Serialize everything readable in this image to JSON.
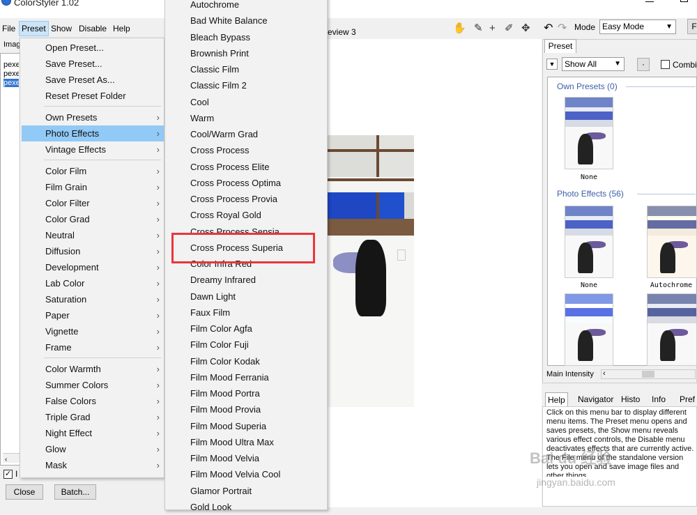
{
  "app": {
    "title": "ColorStyler 1.02"
  },
  "menubar": [
    {
      "label": "File"
    },
    {
      "label": "Preset"
    },
    {
      "label": "Show"
    },
    {
      "label": "Disable"
    },
    {
      "label": "Help"
    }
  ],
  "left_panel": {
    "label": "Imag",
    "files": [
      "pexe",
      "pexe",
      "pexe"
    ],
    "checkbox_label": "I",
    "close_label": "Close",
    "batch_label": "Batch..."
  },
  "preview_tab": "eview 3",
  "preset_menu": {
    "items": [
      {
        "label": "Open Preset...",
        "arrow": ""
      },
      {
        "label": "Save Preset...",
        "arrow": ""
      },
      {
        "label": "Save Preset As...",
        "arrow": ""
      },
      {
        "label": "Reset Preset Folder",
        "arrow": ""
      },
      {
        "label": "Own Presets",
        "arrow": "›"
      },
      {
        "label": "Photo Effects",
        "arrow": "›"
      },
      {
        "label": "Vintage Effects",
        "arrow": "›"
      },
      {
        "label": "Color Film",
        "arrow": "›"
      },
      {
        "label": "Film Grain",
        "arrow": "›"
      },
      {
        "label": "Color Filter",
        "arrow": "›"
      },
      {
        "label": "Color Grad",
        "arrow": "›"
      },
      {
        "label": "Neutral",
        "arrow": "›"
      },
      {
        "label": "Diffusion",
        "arrow": "›"
      },
      {
        "label": "Development",
        "arrow": "›"
      },
      {
        "label": "Lab Color",
        "arrow": "›"
      },
      {
        "label": "Saturation",
        "arrow": "›"
      },
      {
        "label": "Paper",
        "arrow": "›"
      },
      {
        "label": "Vignette",
        "arrow": "›"
      },
      {
        "label": "Frame",
        "arrow": "›"
      },
      {
        "label": "Color Warmth",
        "arrow": "›"
      },
      {
        "label": "Summer Colors",
        "arrow": "›"
      },
      {
        "label": "False Colors",
        "arrow": "›"
      },
      {
        "label": "Triple Grad",
        "arrow": "›"
      },
      {
        "label": "Night Effect",
        "arrow": "›"
      },
      {
        "label": "Glow",
        "arrow": "›"
      },
      {
        "label": "Mask",
        "arrow": "›"
      }
    ]
  },
  "photo_effects_menu": {
    "items": [
      "Autochrome",
      "Bad White Balance",
      "Bleach Bypass",
      "Brownish Print",
      "Classic Film",
      "Classic Film 2",
      "Cool",
      "Warm",
      "Cool/Warm Grad",
      "Cross Process",
      "Cross Process Elite",
      "Cross Process Optima",
      "Cross Process Provia",
      "Cross Royal Gold",
      "Cross Process Sensia",
      "Cross Process Superia",
      "Color Infra Red",
      "Dreamy Infrared",
      "Dawn Light",
      "Faux Film",
      "Film Color Agfa",
      "Film Color Fuji",
      "Film Color Kodak",
      "Film Mood Ferrania",
      "Film Mood Portra",
      "Film Mood Provia",
      "Film Mood Superia",
      "Film Mood Ultra Max",
      "Film Mood Velvia",
      "Film Mood Velvia Cool",
      "Glamor Portrait",
      "Gold Look"
    ]
  },
  "toolbar": {
    "icons": [
      "hand-icon",
      "eyedropper-icon",
      "crosshair-icon",
      "brush-icon",
      "move-icon"
    ],
    "undo": "↶",
    "redo": "↷"
  },
  "right_header": {
    "mode_label": "Mode",
    "mode_value": "Easy Mode",
    "extra_button": "F"
  },
  "preset_panel": {
    "tab": "Preset",
    "filter": "Show All",
    "dot_button": "·",
    "combine_label": "Combin",
    "own_presets_title": "Own Presets (0)",
    "photo_effects_title": "Photo Effects (56)",
    "thumb_labels": [
      "None",
      "None",
      "Autochrome"
    ],
    "main_intensity": "Main Intensity"
  },
  "help_panel": {
    "tabs": [
      "Help",
      "Navigator",
      "Histo",
      "Info",
      "Pref"
    ],
    "text": "Click on this menu bar to display different menu items. The Preset menu opens and saves presets, the Show menu reveals various effect controls, the Disable menu deactivates effects that are currently active. The File menu of the standalone version lets you open and save image files and other things."
  },
  "watermark": {
    "line1": "Bai du 经验",
    "line2": "jingyan.baidu.com"
  }
}
